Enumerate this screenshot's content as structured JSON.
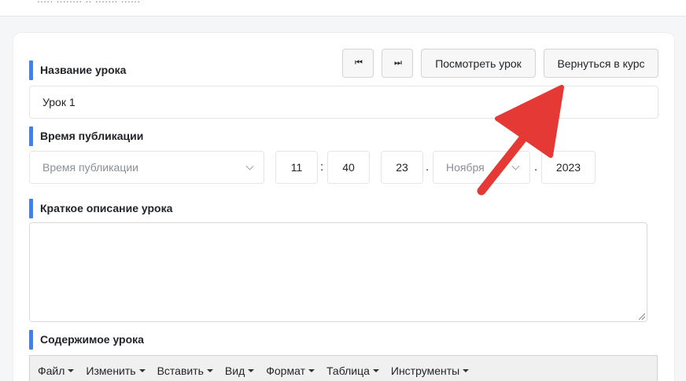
{
  "topbar": {
    "text": "..... ........ .. ....... ......"
  },
  "buttons": {
    "prev_label": "⏮",
    "next_label": "⏭",
    "view_label": "Посмотреть урок",
    "back_label": "Вернуться в курс"
  },
  "lesson_name": {
    "label": "Название урока",
    "value": "Урок 1"
  },
  "publish": {
    "label": "Время публикации",
    "select_placeholder": "Время публикации",
    "hour": "11",
    "minute": "40",
    "day": "23",
    "month": "Ноября",
    "year": "2023",
    "time_sep": ":",
    "date_sep": "."
  },
  "description": {
    "label": "Краткое описание урока",
    "value": ""
  },
  "content": {
    "label": "Содержимое урока",
    "menu": [
      "Файл",
      "Изменить",
      "Вставить",
      "Вид",
      "Формат",
      "Таблица",
      "Инструменты"
    ]
  },
  "colors": {
    "accent": "#3b82f6",
    "annotation_arrow": "#e53935"
  }
}
